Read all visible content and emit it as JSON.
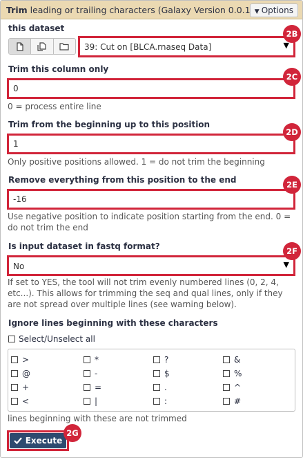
{
  "header": {
    "title_bold": "Trim",
    "title_rest": " leading or trailing characters (Galaxy Version 0.0.1)",
    "options_label": "Options"
  },
  "dataset": {
    "label": "this dataset",
    "selected": "39: Cut on [BLCA.rnaseq Data]",
    "badge": "2B"
  },
  "column": {
    "label": "Trim this column only",
    "value": "0",
    "help": "0 = process entire line",
    "badge": "2C"
  },
  "start": {
    "label": "Trim from the beginning up to this position",
    "value": "1",
    "help": "Only positive positions allowed. 1 = do not trim the beginning",
    "badge": "2D"
  },
  "end": {
    "label": "Remove everything from this position to the end",
    "value": "-16",
    "help": "Use negative position to indicate position starting from the end. 0 = do not trim the end",
    "badge": "2E"
  },
  "fastq": {
    "label": "Is input dataset in fastq format?",
    "selected": "No",
    "help": "If set to YES, the tool will not trim evenly numbered lines (0, 2, 4, etc...). This allows for trimming the seq and qual lines, only if they are not spread over multiple lines (see warning below).",
    "badge": "2F"
  },
  "ignore": {
    "label": "Ignore lines beginning with these characters",
    "select_all": "Select/Unselect all",
    "chars": [
      ">",
      "*",
      "?",
      "&",
      "@",
      "-",
      "$",
      "%",
      "+",
      "=",
      ".",
      "^",
      "<",
      "|",
      ":",
      "#"
    ],
    "help": "lines beginning with these are not trimmed"
  },
  "execute": {
    "label": "Execute",
    "badge": "2G"
  },
  "colors": {
    "header_bg": "#ebd9b2",
    "highlight": "#d1253a",
    "execute_bg": "#2d4a6f"
  }
}
